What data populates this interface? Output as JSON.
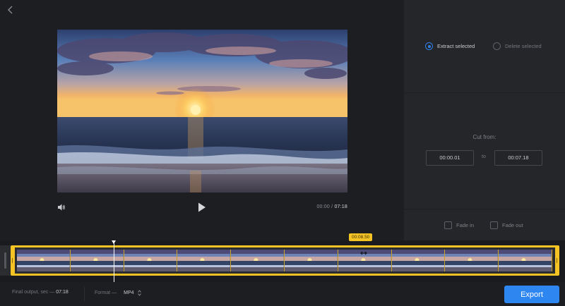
{
  "player": {
    "current_time": "00:00",
    "separator": "/",
    "duration": "07:18"
  },
  "mode": {
    "extract_label": "Extract selected",
    "delete_label": "Delete selected",
    "selected": "extract"
  },
  "cut": {
    "label": "Cut from:",
    "start": "00:00.01",
    "to_label": "to",
    "end": "00:07.18"
  },
  "fades": {
    "fade_in_label": "Fade in",
    "fade_out_label": "Fade out"
  },
  "timeline": {
    "tooltip": "00:08.50",
    "frame_count": 10
  },
  "footer": {
    "final_output_label": "Final output, sec —",
    "final_output_value": "07:18",
    "format_label": "Format —",
    "format_value": "MP4",
    "export_label": "Export"
  },
  "colors": {
    "accent": "#2e86f0",
    "selection": "#f5c324"
  },
  "icons": [
    "back-icon",
    "volume-icon",
    "play-icon",
    "chevron-updown-icon",
    "resize-cursor-icon"
  ]
}
